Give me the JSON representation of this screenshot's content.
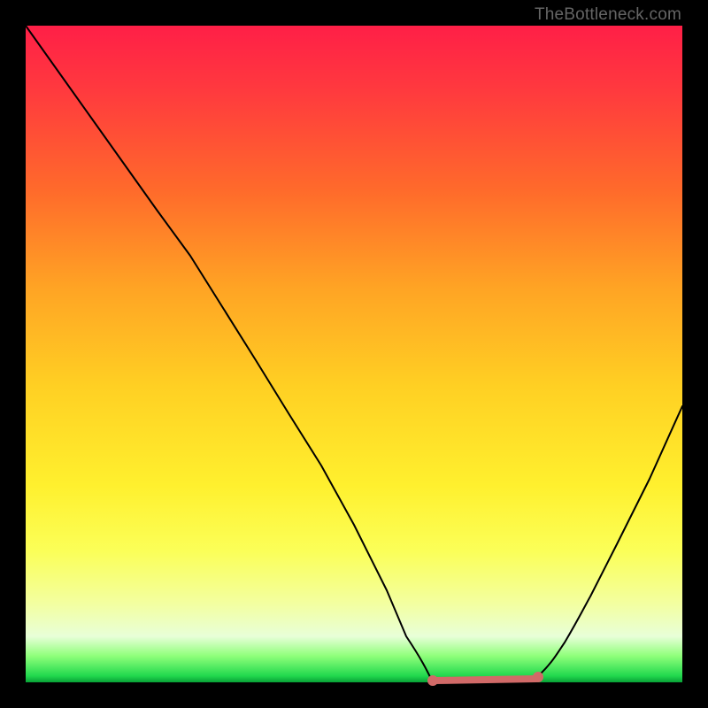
{
  "attribution": "TheBottleneck.com",
  "chart_data": {
    "type": "line",
    "title": "",
    "xlabel": "",
    "ylabel": "",
    "xlim": [
      0,
      100
    ],
    "ylim": [
      0,
      100
    ],
    "x": [
      0,
      5,
      10,
      15,
      20,
      25,
      30,
      35,
      40,
      45,
      50,
      55,
      58,
      62,
      66,
      70,
      74,
      78,
      82,
      86,
      90,
      95,
      100
    ],
    "values": [
      100,
      93,
      86,
      79,
      72,
      65,
      57,
      49,
      41,
      33,
      24,
      14,
      7,
      2,
      0,
      0,
      0,
      1,
      6,
      13,
      21,
      31,
      42
    ],
    "annotations": [
      {
        "kind": "trough-highlight",
        "x_start": 62,
        "x_end": 78,
        "color": "#d16a68"
      }
    ],
    "colors": {
      "curve": "#000000",
      "background_gradient": [
        "#ff1f47",
        "#ff6a2b",
        "#ffd023",
        "#fbff58",
        "#e8ffd8",
        "#22d94e"
      ],
      "highlight": "#d16a68"
    }
  }
}
